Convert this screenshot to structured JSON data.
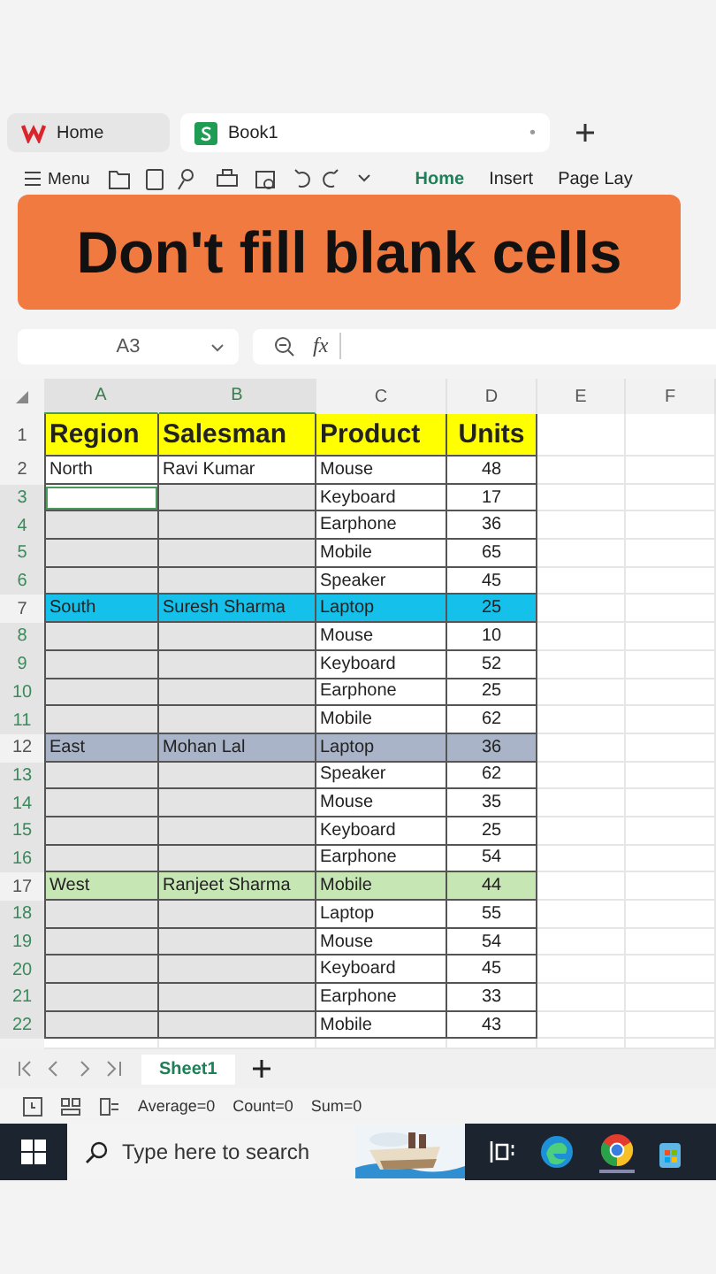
{
  "tabs": [
    {
      "label": "Home",
      "selected": false
    },
    {
      "label": "Book1",
      "selected": true,
      "unsaved_mark": "•"
    }
  ],
  "toolbar": {
    "menu": "Menu",
    "ribbon_tabs": [
      {
        "label": "Home",
        "selected": true
      },
      {
        "label": "Insert",
        "selected": false
      },
      {
        "label": "Page Lay",
        "selected": false
      }
    ]
  },
  "banner": {
    "text": "Don't fill blank cells"
  },
  "formula_bar": {
    "name_box": "A3",
    "fx": "fx"
  },
  "columns": [
    {
      "label": "A",
      "selected": true
    },
    {
      "label": "B",
      "selected": true
    },
    {
      "label": "C",
      "selected": false
    },
    {
      "label": "D",
      "selected": false
    },
    {
      "label": "E",
      "selected": false
    },
    {
      "label": "F",
      "selected": false
    }
  ],
  "rows": [
    {
      "number": "1",
      "cells": [
        "Region",
        "Salesman",
        "Product",
        "Units"
      ],
      "color": "#ffff00",
      "selected": false
    },
    {
      "number": "2",
      "cells": [
        "North",
        "Ravi Kumar",
        "Mouse",
        "48"
      ],
      "selected": false
    },
    {
      "number": "3",
      "cells": [
        "",
        "",
        "Keyboard",
        "17"
      ],
      "selected": true,
      "active": true
    },
    {
      "number": "4",
      "cells": [
        "",
        "",
        "Earphone",
        "36"
      ],
      "selected": true
    },
    {
      "number": "5",
      "cells": [
        "",
        "",
        "Mobile",
        "65"
      ],
      "selected": true
    },
    {
      "number": "6",
      "cells": [
        "",
        "",
        "Speaker",
        "45"
      ],
      "selected": true
    },
    {
      "number": "7",
      "cells": [
        "South",
        "Suresh Sharma",
        "Laptop",
        "25"
      ],
      "color": "#15c0ea",
      "selected": false
    },
    {
      "number": "8",
      "cells": [
        "",
        "",
        "Mouse",
        "10"
      ],
      "selected": true
    },
    {
      "number": "9",
      "cells": [
        "",
        "",
        "Keyboard",
        "52"
      ],
      "selected": true
    },
    {
      "number": "10",
      "cells": [
        "",
        "",
        "Earphone",
        "25"
      ],
      "selected": true
    },
    {
      "number": "11",
      "cells": [
        "",
        "",
        "Mobile",
        "62"
      ],
      "selected": true
    },
    {
      "number": "12",
      "cells": [
        "East",
        "Mohan Lal",
        "Laptop",
        "36"
      ],
      "color": "#aab4c8",
      "selected": false
    },
    {
      "number": "13",
      "cells": [
        "",
        "",
        "Speaker",
        "62"
      ],
      "selected": true
    },
    {
      "number": "14",
      "cells": [
        "",
        "",
        "Mouse",
        "35"
      ],
      "selected": true
    },
    {
      "number": "15",
      "cells": [
        "",
        "",
        "Keyboard",
        "25"
      ],
      "selected": true
    },
    {
      "number": "16",
      "cells": [
        "",
        "",
        "Earphone",
        "54"
      ],
      "selected": true
    },
    {
      "number": "17",
      "cells": [
        "West",
        "Ranjeet Sharma",
        "Mobile",
        "44"
      ],
      "color": "#c6e6b4",
      "selected": false
    },
    {
      "number": "18",
      "cells": [
        "",
        "",
        "Laptop",
        "55"
      ],
      "selected": true
    },
    {
      "number": "19",
      "cells": [
        "",
        "",
        "Mouse",
        "54"
      ],
      "selected": true
    },
    {
      "number": "20",
      "cells": [
        "",
        "",
        "Keyboard",
        "45"
      ],
      "selected": true
    },
    {
      "number": "21",
      "cells": [
        "",
        "",
        "Earphone",
        "33"
      ],
      "selected": true
    },
    {
      "number": "22",
      "cells": [
        "",
        "",
        "Mobile",
        "43"
      ],
      "selected": true
    }
  ],
  "sheet_tabs": [
    {
      "label": "Sheet1",
      "selected": true
    }
  ],
  "status_bar": {
    "readings": [
      "Average=0",
      "Count=0",
      "Sum=0"
    ]
  },
  "taskbar": {
    "search": {
      "placeholder": "Type here to search"
    }
  }
}
